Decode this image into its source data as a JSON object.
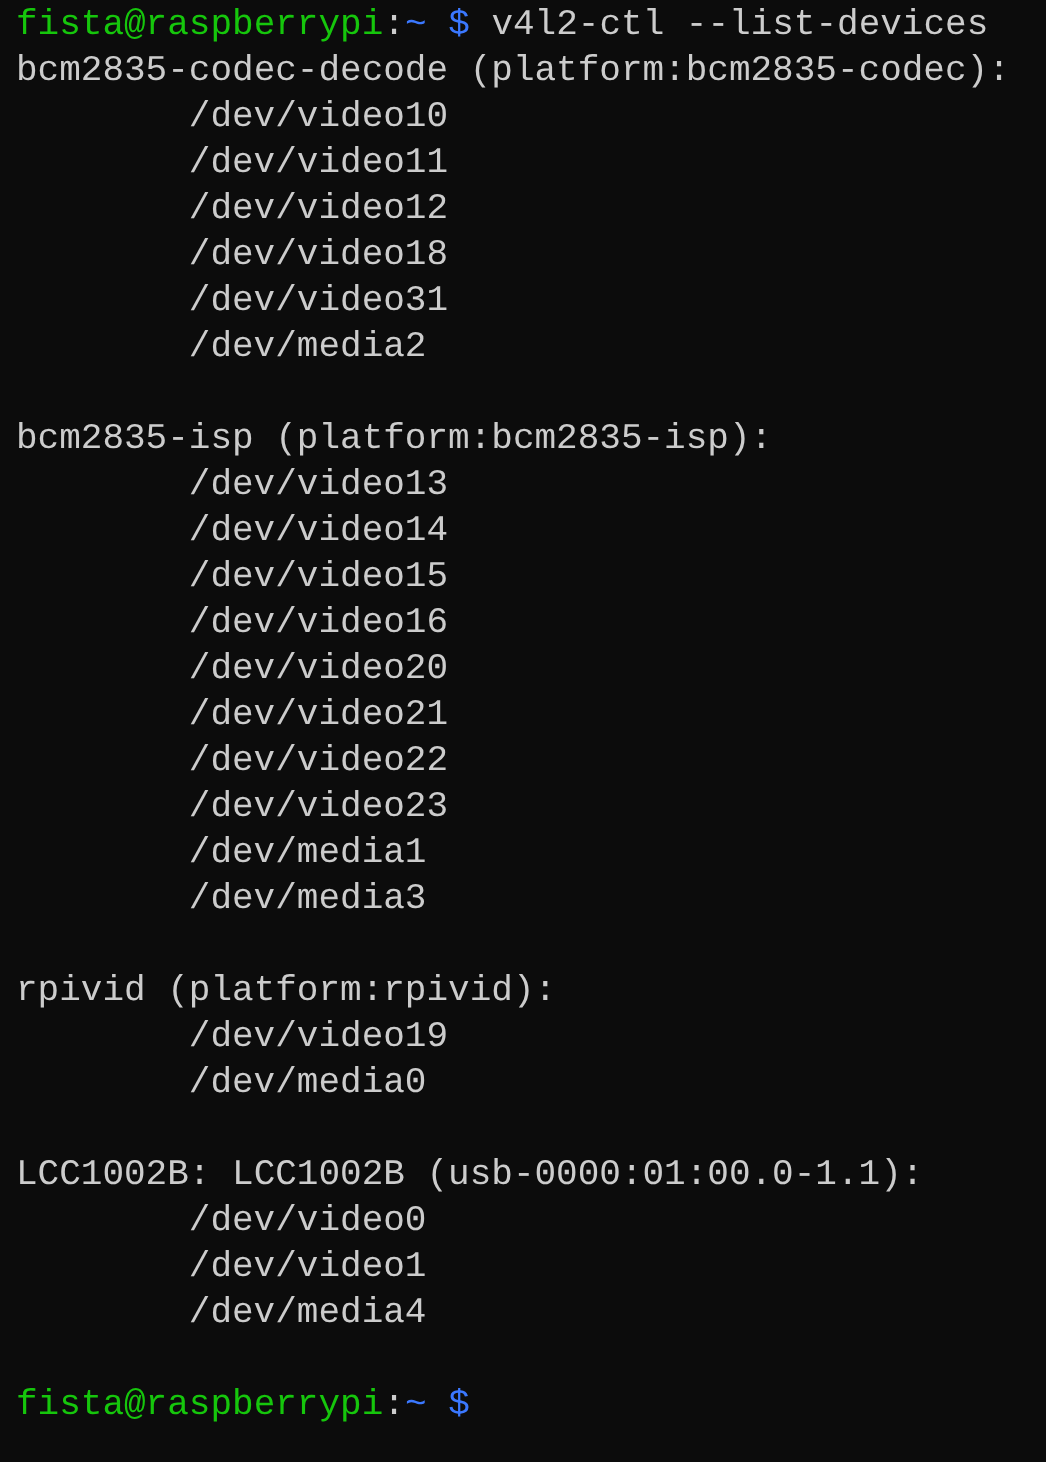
{
  "terminal": {
    "lines": [
      {
        "kind": "prompt",
        "user_host": "fista@raspberrypi",
        "separator": ":",
        "path": "~",
        "symbol": "$",
        "command": "v4l2-ctl --list-devices"
      },
      {
        "kind": "header",
        "text": "bcm2835-codec-decode (platform:bcm2835-codec):"
      },
      {
        "kind": "device",
        "text": "/dev/video10"
      },
      {
        "kind": "device",
        "text": "/dev/video11"
      },
      {
        "kind": "device",
        "text": "/dev/video12"
      },
      {
        "kind": "device",
        "text": "/dev/video18"
      },
      {
        "kind": "device",
        "text": "/dev/video31"
      },
      {
        "kind": "device",
        "text": "/dev/media2"
      },
      {
        "kind": "blank"
      },
      {
        "kind": "header",
        "text": "bcm2835-isp (platform:bcm2835-isp):"
      },
      {
        "kind": "device",
        "text": "/dev/video13"
      },
      {
        "kind": "device",
        "text": "/dev/video14"
      },
      {
        "kind": "device",
        "text": "/dev/video15"
      },
      {
        "kind": "device",
        "text": "/dev/video16"
      },
      {
        "kind": "device",
        "text": "/dev/video20"
      },
      {
        "kind": "device",
        "text": "/dev/video21"
      },
      {
        "kind": "device",
        "text": "/dev/video22"
      },
      {
        "kind": "device",
        "text": "/dev/video23"
      },
      {
        "kind": "device",
        "text": "/dev/media1"
      },
      {
        "kind": "device",
        "text": "/dev/media3"
      },
      {
        "kind": "blank"
      },
      {
        "kind": "header",
        "text": "rpivid (platform:rpivid):"
      },
      {
        "kind": "device",
        "text": "/dev/video19"
      },
      {
        "kind": "device",
        "text": "/dev/media0"
      },
      {
        "kind": "blank"
      },
      {
        "kind": "header",
        "text": "LCC1002B: LCC1002B (usb-0000:01:00.0-1.1):"
      },
      {
        "kind": "device",
        "text": "/dev/video0"
      },
      {
        "kind": "device",
        "text": "/dev/video1"
      },
      {
        "kind": "device",
        "text": "/dev/media4"
      },
      {
        "kind": "blank"
      },
      {
        "kind": "prompt",
        "user_host": "fista@raspberrypi",
        "separator": ":",
        "path": "~",
        "symbol": "$"
      }
    ]
  }
}
